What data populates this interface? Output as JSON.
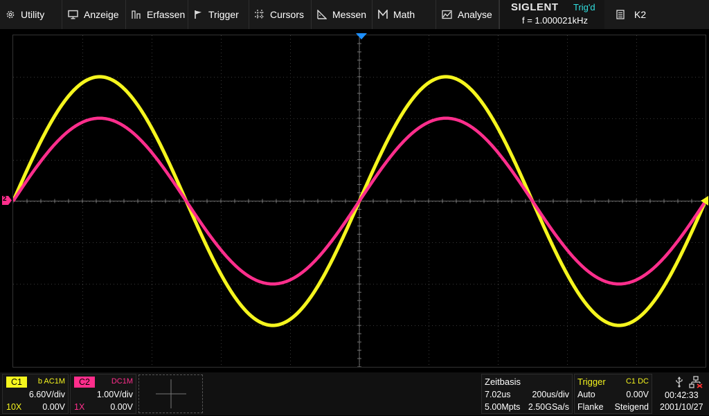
{
  "menu": {
    "utility": "Utility",
    "display": "Anzeige",
    "acquire": "Erfassen",
    "trigger": "Trigger",
    "cursors": "Cursors",
    "measure": "Messen",
    "math": "Math",
    "analysis": "Analyse"
  },
  "status": {
    "brand": "SIGLENT",
    "trig_state": "Trig'd",
    "frequency": "f = 1.000021kHz",
    "k2": "K2"
  },
  "colors": {
    "ch1": "#f5f51e",
    "ch2": "#ff2e8c",
    "trigger_cursor": "#1e90ff",
    "status_cyan": "#31e0e0"
  },
  "channels": {
    "c1": {
      "label": "C1",
      "coupling": "b AC1M",
      "scale": "6.60V/div",
      "probe": "10X",
      "offset": "0.00V"
    },
    "c2": {
      "label": "C2",
      "coupling": "DC1M",
      "scale": "1.00V/div",
      "probe": "1X",
      "offset": "0.00V"
    }
  },
  "timebase": {
    "title": "Zeitbasis",
    "delay": "7.02us",
    "scale": "200us/div",
    "memory": "5.00Mpts",
    "sample_rate": "2.50GSa/s"
  },
  "trigger": {
    "title": "Trigger",
    "source": "C1 DC",
    "mode": "Auto",
    "level": "0.00V",
    "type": "Flanke",
    "slope": "Steigend"
  },
  "clock": {
    "time": "00:42:33",
    "date": "2001/10/27"
  },
  "markers": {
    "ch2_level": "2"
  },
  "waveforms": {
    "time_per_div_us": 200,
    "divisions_h": 10,
    "divisions_v": 8,
    "frequency_khz": 1.0,
    "ch1_amplitude_div": 3.0,
    "ch2_amplitude_div": 2.0
  }
}
